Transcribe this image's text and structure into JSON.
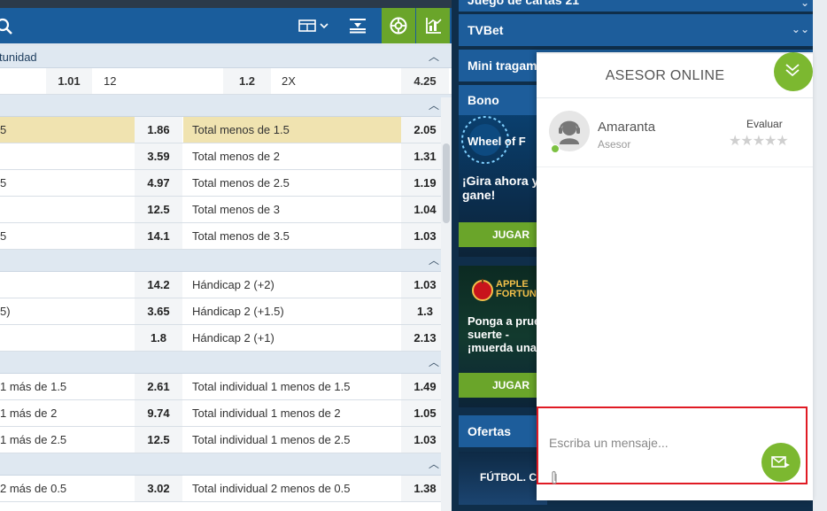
{
  "toolbar": {
    "icons": [
      "search-icon",
      "layout-icon",
      "chevron-down-icon",
      "align-icon",
      "live-icon",
      "stats-icon"
    ],
    "accent": "#6aa52a"
  },
  "market_line": {
    "section_title": "tunidad",
    "cells": [
      "1.01",
      "12",
      "1.2",
      "2X",
      "4.25"
    ]
  },
  "totals": {
    "rows": [
      {
        "left": "5",
        "left_odd": "1.86",
        "right": "Total menos de 1.5",
        "right_odd": "2.05",
        "highlight": true
      },
      {
        "left": "",
        "left_odd": "3.59",
        "right": "Total menos de 2",
        "right_odd": "1.31"
      },
      {
        "left": "5",
        "left_odd": "4.97",
        "right": "Total menos de 2.5",
        "right_odd": "1.19"
      },
      {
        "left": "",
        "left_odd": "12.5",
        "right": "Total menos de 3",
        "right_odd": "1.04"
      },
      {
        "left": "5",
        "left_odd": "14.1",
        "right": "Total menos de 3.5",
        "right_odd": "1.03"
      }
    ]
  },
  "handicap": {
    "rows": [
      {
        "left": "",
        "left_odd": "14.2",
        "right": "Hándicap 2 (+2)",
        "right_odd": "1.03"
      },
      {
        "left": "5)",
        "left_odd": "3.65",
        "right": "Hándicap 2 (+1.5)",
        "right_odd": "1.3"
      },
      {
        "left": "",
        "left_odd": "1.8",
        "right": "Hándicap 2 (+1)",
        "right_odd": "2.13"
      }
    ]
  },
  "individual1": {
    "rows": [
      {
        "left": "1 más de 1.5",
        "left_odd": "2.61",
        "right": "Total individual 1 menos de 1.5",
        "right_odd": "1.49"
      },
      {
        "left": "1 más de 2",
        "left_odd": "9.74",
        "right": "Total individual 1 menos de 2",
        "right_odd": "1.05"
      },
      {
        "left": "1 más de 2.5",
        "left_odd": "12.5",
        "right": "Total individual 1 menos de 2.5",
        "right_odd": "1.03"
      }
    ]
  },
  "individual2": {
    "rows": [
      {
        "left": "2 más de 0.5",
        "left_odd": "3.02",
        "right": "Total individual 2 menos de 0.5",
        "right_odd": "1.38"
      }
    ]
  },
  "right_menu": {
    "top_partial": "Juego de cartas 21",
    "tvbet": "TVBet",
    "mini": "Mini tragam",
    "bono": "Bono",
    "banner1_title": "Wheel of F",
    "banner1_text": "¡Gira ahora y gane!",
    "jugar": "JUGAR",
    "banner2_title": "APPLE FORTUN",
    "banner2_text": "Ponga a prue suerte - ¡muerda una",
    "ofertas": "Ofertas",
    "futbol": "FÚTBOL. C"
  },
  "chat": {
    "title": "ASESOR ONLINE",
    "agent_name": "Amaranta",
    "agent_role": "Asesor",
    "rate_label": "Evaluar",
    "stars": "★★★★★",
    "placeholder": "Escriba un mensaje...",
    "highlight_color": "#e01b24"
  }
}
